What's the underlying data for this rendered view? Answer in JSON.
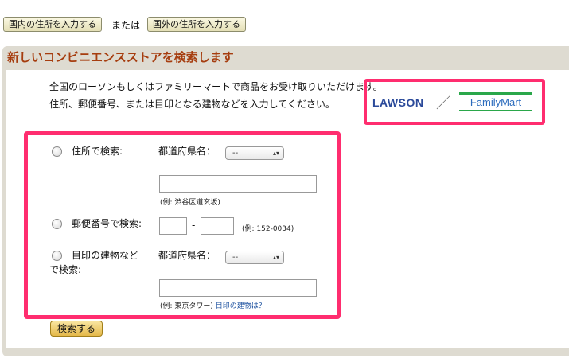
{
  "top": {
    "domestic_button": "国内の住所を入力する",
    "or_text": "または",
    "overseas_button": "国外の住所を入力する"
  },
  "panel": {
    "title": "新しいコンビニエンスストアを検索します",
    "intro_line1": "全国のローソンもしくはファミリーマートで商品をお受け取りいただけます。",
    "intro_line2": "住所、郵便番号、または目印となる建物などを入力してください。",
    "logos": {
      "lawson": "LAWSON",
      "separator": "／",
      "familymart": "FamilyMart"
    }
  },
  "form": {
    "by_address": {
      "label": "住所で検索:",
      "pref_label": "都道府県名：",
      "pref_value": "--",
      "input_value": "",
      "example": "(例: 渋谷区道玄坂)"
    },
    "by_postal": {
      "label": "郵便番号で検索:",
      "part1": "",
      "dash": "-",
      "part2": "",
      "example": "(例: 152-0034)"
    },
    "by_landmark": {
      "label_line1": "目印の建物など",
      "label_line2": "で検索:",
      "pref_label": "都道府県名：",
      "pref_value": "--",
      "input_value": "",
      "example": "(例: 東京タワー)",
      "help_link": "目印の建物は？"
    },
    "search_button": "検索する"
  },
  "colors": {
    "highlight": "#ff2d6f",
    "title": "#a63d0f",
    "panel": "#dedbd1"
  },
  "icons": {
    "select_arrow": "updown-arrow-icon",
    "radio": "radio-icon"
  }
}
